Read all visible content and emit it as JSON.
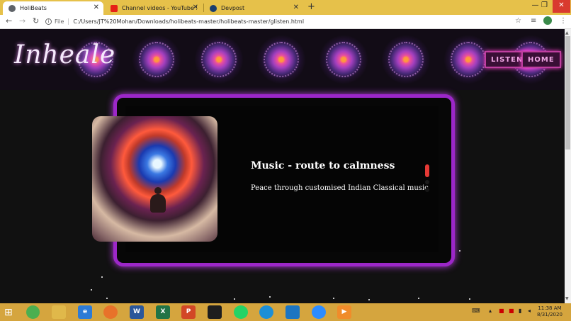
{
  "browser": {
    "tabs": [
      {
        "title": "HoliBeats",
        "favicon": "globe-icon",
        "active": true
      },
      {
        "title": "Channel videos - YouTube Studio",
        "favicon": "youtube-icon",
        "active": false
      },
      {
        "title": "Devpost",
        "favicon": "devpost-icon",
        "active": false
      }
    ],
    "new_tab": "+",
    "window_controls": {
      "minimize": "—",
      "restore": "❐",
      "close": "✕"
    },
    "nav": {
      "back": "←",
      "forward": "→",
      "reload": "↻"
    },
    "address": {
      "security_label": "File",
      "url": "C:/Users/JT%20Mohan/Downloads/holibeats-master/holibeats-master/glisten.html"
    }
  },
  "site": {
    "logo": "Inheale",
    "nav": {
      "listen": "LISTEN",
      "home": "HOME"
    }
  },
  "card": {
    "title": "Music - route to calmness",
    "subtitle": "Peace through customised Indian Classical music",
    "image_desc_icon": "meditation-nebula-image"
  },
  "taskbar": {
    "apps": [
      "chrome",
      "file-explorer",
      "edge-legacy",
      "firefox",
      "word",
      "excel",
      "powerpoint",
      "terminal",
      "whatsapp",
      "edge",
      "vscode",
      "zoom",
      "media-player"
    ],
    "clock": {
      "time": "11:38 AM",
      "date": "8/31/2020"
    }
  },
  "colors": {
    "tabbar": "#e6c14a",
    "taskbar": "#d5a53e",
    "card_border": "#9c27c8",
    "active_dot": "#e53935",
    "nav_glow": "#ff3fcf"
  }
}
